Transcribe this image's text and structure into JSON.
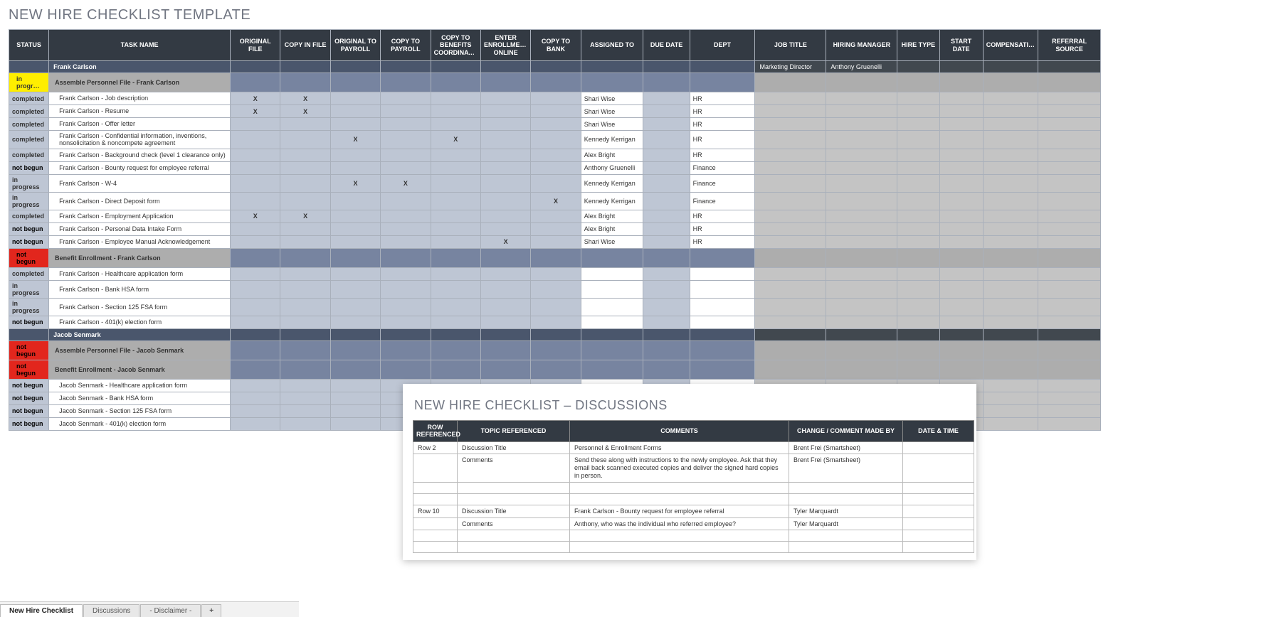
{
  "title": "NEW HIRE CHECKLIST TEMPLATE",
  "columns": [
    "STATUS",
    "TASK NAME",
    "ORIGINAL FILE",
    "COPY IN FILE",
    "ORIGINAL TO PAYROLL",
    "COPY TO PAYROLL",
    "COPY TO BENEFITS COORDINATOR",
    "ENTER ENROLLMENT ONLINE",
    "COPY TO BANK",
    "ASSIGNED TO",
    "DUE DATE",
    "DEPT",
    "JOB TITLE",
    "HIRING MANAGER",
    "HIRE TYPE",
    "START DATE",
    "COMPENSATION",
    "REFERRAL SOURCE"
  ],
  "rows": [
    {
      "type": "name",
      "task": "Frank Carlson",
      "job": "Marketing Director",
      "hm": "Anthony Gruenelli"
    },
    {
      "type": "group",
      "status": "in progress",
      "task": "Assemble Personnel File - Frank Carlson"
    },
    {
      "type": "data",
      "status": "completed",
      "task": "Frank Carlson - Job description",
      "of": "X",
      "cf": "X",
      "assigned": "Shari Wise",
      "dept": "HR"
    },
    {
      "type": "data",
      "status": "completed",
      "task": "Frank Carlson - Resume",
      "of": "X",
      "cf": "X",
      "assigned": "Shari Wise",
      "dept": "HR"
    },
    {
      "type": "data",
      "status": "completed",
      "task": "Frank Carlson - Offer letter",
      "assigned": "Shari Wise",
      "dept": "HR"
    },
    {
      "type": "data",
      "status": "completed",
      "task": "Frank Carlson - Confidential information, inventions, nonsolicitation & noncompete agreement",
      "op": "X",
      "bc": "X",
      "assigned": "Kennedy Kerrigan",
      "dept": "HR"
    },
    {
      "type": "data",
      "status": "completed",
      "task": "Frank Carlson - Background check (level 1 clearance only)",
      "assigned": "Alex Bright",
      "dept": "HR"
    },
    {
      "type": "data",
      "status": "not begun",
      "task": "Frank Carlson - Bounty request for employee referral",
      "assigned": "Anthony Gruenelli",
      "dept": "Finance"
    },
    {
      "type": "data",
      "status": "in progress",
      "task": "Frank Carlson - W-4",
      "op": "X",
      "cp": "X",
      "assigned": "Kennedy Kerrigan",
      "dept": "Finance"
    },
    {
      "type": "data",
      "status": "in progress",
      "task": "Frank Carlson - Direct Deposit form",
      "cb": "X",
      "assigned": "Kennedy Kerrigan",
      "dept": "Finance"
    },
    {
      "type": "data",
      "status": "completed",
      "task": "Frank Carlson - Employment Application",
      "of": "X",
      "cf": "X",
      "assigned": "Alex Bright",
      "dept": "HR"
    },
    {
      "type": "data",
      "status": "not begun",
      "task": "Frank Carlson - Personal Data Intake Form",
      "assigned": "Alex Bright",
      "dept": "HR"
    },
    {
      "type": "data",
      "status": "not begun",
      "task": "Frank Carlson - Employee Manual Acknowledgement",
      "eo": "X",
      "assigned": "Shari Wise",
      "dept": "HR"
    },
    {
      "type": "group",
      "status": "not begun",
      "task": "Benefit Enrollment - Frank Carlson"
    },
    {
      "type": "data",
      "status": "completed",
      "task": "Frank Carlson - Healthcare application form"
    },
    {
      "type": "data",
      "status": "in progress",
      "task": "Frank Carlson - Bank HSA form"
    },
    {
      "type": "data",
      "status": "in progress",
      "task": "Frank Carlson - Section 125 FSA form"
    },
    {
      "type": "data",
      "status": "not begun",
      "task": "Frank Carlson - 401(k) election form"
    },
    {
      "type": "name",
      "task": "Jacob Senmark"
    },
    {
      "type": "group",
      "status": "not begun",
      "task": "Assemble Personnel File - Jacob Senmark"
    },
    {
      "type": "group",
      "status": "not begun",
      "task": "Benefit Enrollment - Jacob Senmark"
    },
    {
      "type": "data",
      "status": "not begun",
      "task": "Jacob Senmark - Healthcare application form"
    },
    {
      "type": "data",
      "status": "not begun",
      "task": "Jacob Senmark - Bank HSA form"
    },
    {
      "type": "data",
      "status": "not begun",
      "task": "Jacob Senmark - Section 125 FSA form"
    },
    {
      "type": "data",
      "status": "not begun",
      "task": "Jacob Senmark - 401(k) election form"
    }
  ],
  "disc": {
    "title": "NEW HIRE CHECKLIST  –  DISCUSSIONS",
    "columns": [
      "ROW REFERENCED",
      "TOPIC REFERENCED",
      "COMMENTS",
      "CHANGE / COMMENT MADE BY",
      "DATE & TIME"
    ],
    "rows": [
      {
        "row": "Row 2",
        "topic": "Discussion Title",
        "comments": "Personnel & Enrollment Forms",
        "who": "Brent Frei (Smartsheet)",
        "when": ""
      },
      {
        "row": "",
        "topic": "Comments",
        "comments": "Send these along with instructions to the newly employee.  Ask that they email back scanned executed copies and deliver the signed hard copies in person.",
        "who": "Brent Frei (Smartsheet)",
        "when": ""
      },
      {
        "row": "",
        "topic": "",
        "comments": "",
        "who": "",
        "when": ""
      },
      {
        "row": "",
        "topic": "",
        "comments": "",
        "who": "",
        "when": ""
      },
      {
        "row": "Row 10",
        "topic": "Discussion Title",
        "comments": "Frank Carlson - Bounty request for employee referral",
        "who": "Tyler Marquardt",
        "when": ""
      },
      {
        "row": "",
        "topic": "Comments",
        "comments": "Anthony, who was the individual who referred employee?",
        "who": "Tyler Marquardt",
        "when": ""
      },
      {
        "row": "",
        "topic": "",
        "comments": "",
        "who": "",
        "when": ""
      },
      {
        "row": "",
        "topic": "",
        "comments": "",
        "who": "",
        "when": ""
      }
    ]
  },
  "tabs": {
    "active": "New Hire Checklist",
    "items": [
      "New Hire Checklist",
      "Discussions",
      "- Disclaimer -"
    ],
    "add": "+"
  }
}
